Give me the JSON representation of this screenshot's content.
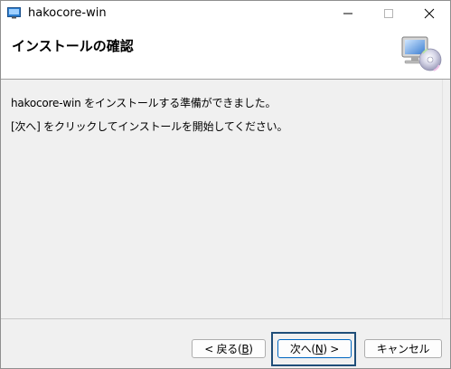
{
  "window": {
    "title": "hakocore-win"
  },
  "banner": {
    "title": "インストールの確認"
  },
  "body": {
    "line1": "hakocore-win をインストールする準備ができました。",
    "line2": "[次へ] をクリックしてインストールを開始してください。"
  },
  "buttons": {
    "back_pre": "< 戻る(",
    "back_key": "B",
    "back_post": ")",
    "next_pre": "次へ(",
    "next_key": "N",
    "next_post": ") >",
    "cancel": "キャンセル"
  },
  "icons": {
    "app": "installer-app-icon",
    "banner": "computer-cd-icon",
    "minimize": "minimize-icon",
    "maximize": "maximize-icon",
    "close": "close-icon"
  },
  "colors": {
    "focus": "#1f4e79",
    "default_button_border": "#0067c0",
    "dialog_bg": "#f0f0f0"
  }
}
